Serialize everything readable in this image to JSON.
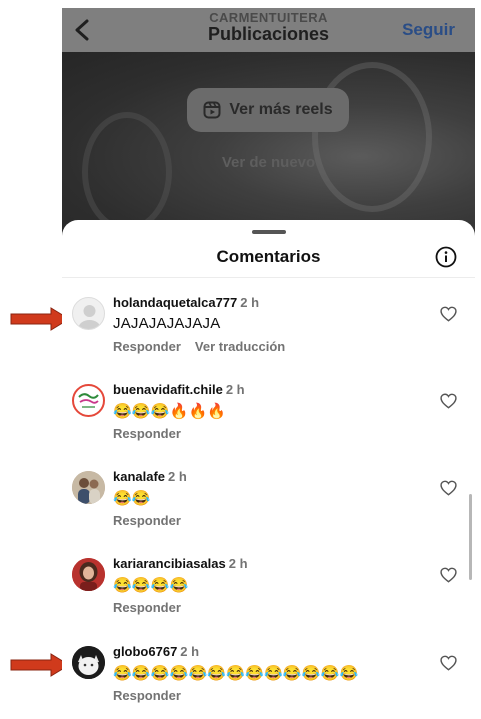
{
  "header": {
    "account": "CARMENTUITERA",
    "title": "Publicaciones",
    "follow_label": "Seguir"
  },
  "reel": {
    "more_reels_label": "Ver más reels",
    "watch_again_label": "Ver de nuevo"
  },
  "comments_sheet": {
    "title": "Comentarios",
    "comments": [
      {
        "user": "holandaquetalca777",
        "time": "2 h",
        "text": "JAJAJAJAJAJA",
        "reply": "Responder",
        "translate": "Ver traducción"
      },
      {
        "user": "buenavidafit.chile",
        "time": "2 h",
        "text": "😂😂😂🔥🔥🔥",
        "reply": "Responder"
      },
      {
        "user": "kanalafe",
        "time": "2 h",
        "text": "😂😂",
        "reply": "Responder"
      },
      {
        "user": "kariarancibiasalas",
        "time": "2 h",
        "text": "😂😂😂😂",
        "reply": "Responder"
      },
      {
        "user": "globo6767",
        "time": "2 h",
        "text": "😂😂😂😂😂😂😂😂😂😂😂😂😂",
        "reply": "Responder"
      }
    ]
  },
  "colors": {
    "arrow": "#d03a1c",
    "follow": "#2a4d86",
    "muted_text": "#737373"
  }
}
